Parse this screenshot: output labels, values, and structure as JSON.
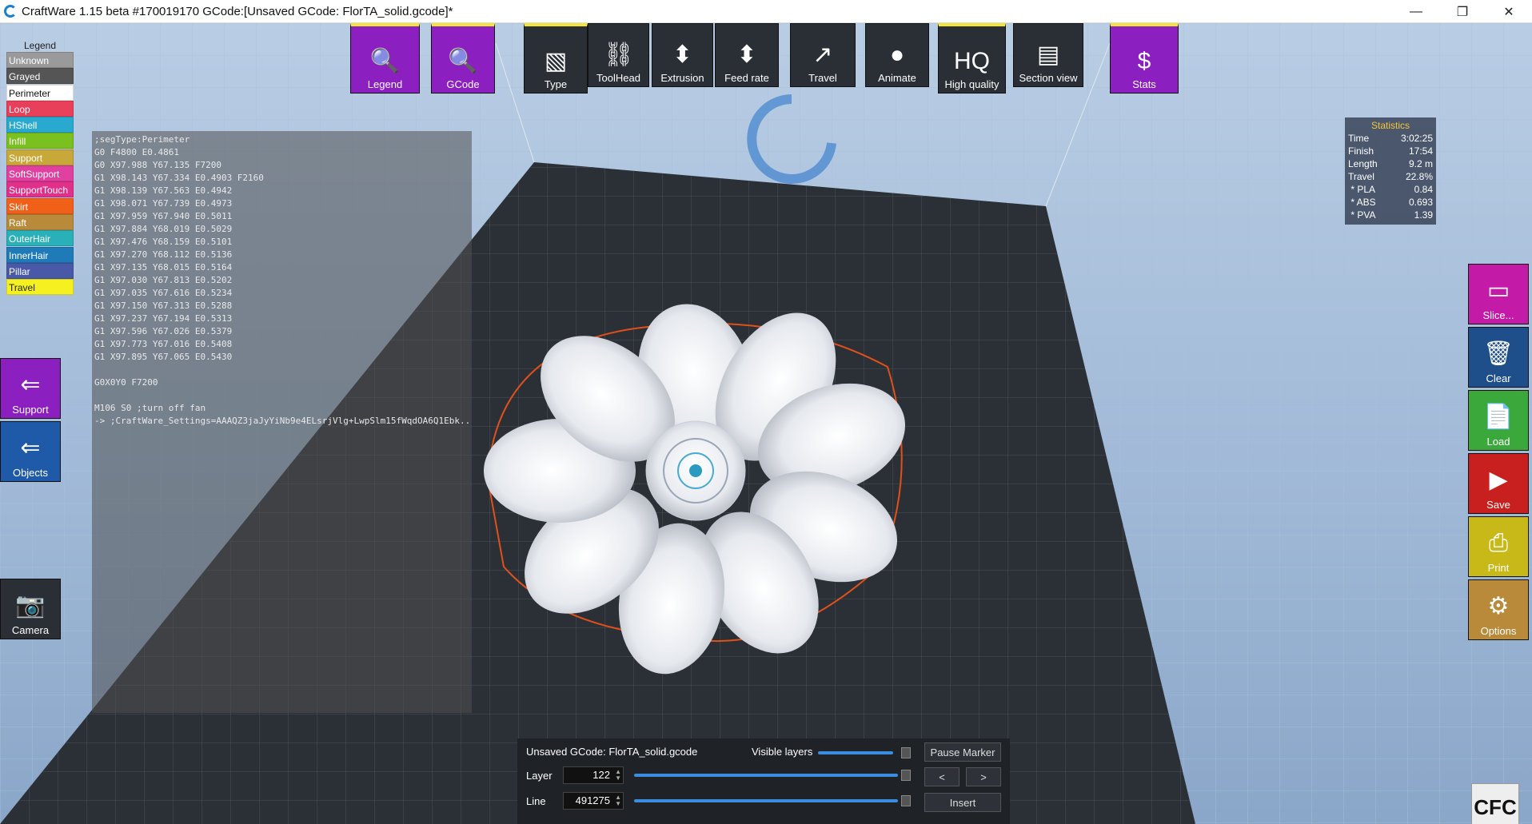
{
  "window": {
    "title": "CraftWare 1.15 beta #170019170   GCode:[Unsaved GCode: FlorTA_solid.gcode]*",
    "minimize": "—",
    "restore": "❐",
    "close": "✕"
  },
  "legend": {
    "title": "Legend",
    "items": [
      {
        "label": "Unknown",
        "color": "#9a9a9a",
        "text": "#ffffff"
      },
      {
        "label": "Grayed",
        "color": "#555555",
        "text": "#ffffff"
      },
      {
        "label": "Perimeter",
        "color": "#ffffff",
        "text": "#111111"
      },
      {
        "label": "Loop",
        "color": "#e8405a",
        "text": "#ffffff"
      },
      {
        "label": "HShell",
        "color": "#2aa9d0",
        "text": "#ffffff"
      },
      {
        "label": "Infill",
        "color": "#7ac01e",
        "text": "#ffffff"
      },
      {
        "label": "Support",
        "color": "#c8a838",
        "text": "#ffffff"
      },
      {
        "label": "SoftSupport",
        "color": "#e040a0",
        "text": "#ffffff"
      },
      {
        "label": "SupportTouch",
        "color": "#e0308a",
        "text": "#ffffff"
      },
      {
        "label": "Skirt",
        "color": "#f06018",
        "text": "#ffffff"
      },
      {
        "label": "Raft",
        "color": "#b88a3a",
        "text": "#ffffff"
      },
      {
        "label": "OuterHair",
        "color": "#2ab0b8",
        "text": "#ffffff"
      },
      {
        "label": "InnerHair",
        "color": "#1f7ab8",
        "text": "#ffffff"
      },
      {
        "label": "Pillar",
        "color": "#4a58a8",
        "text": "#ffffff"
      },
      {
        "label": "Travel",
        "color": "#f5f020",
        "text": "#222222"
      }
    ]
  },
  "gcode_lines": [
    ";segType:Perimeter",
    "G0 F4800 E0.4861",
    "G0 X97.988 Y67.135 F7200",
    "G1 X98.143 Y67.334 E0.4903 F2160",
    "G1 X98.139 Y67.563 E0.4942",
    "G1 X98.071 Y67.739 E0.4973",
    "G1 X97.959 Y67.940 E0.5011",
    "G1 X97.884 Y68.019 E0.5029",
    "G1 X97.476 Y68.159 E0.5101",
    "G1 X97.270 Y68.112 E0.5136",
    "G1 X97.135 Y68.015 E0.5164",
    "G1 X97.030 Y67.813 E0.5202",
    "G1 X97.035 Y67.616 E0.5234",
    "G1 X97.150 Y67.313 E0.5288",
    "G1 X97.237 Y67.194 E0.5313",
    "G1 X97.596 Y67.026 E0.5379",
    "G1 X97.773 Y67.016 E0.5408",
    "G1 X97.895 Y67.065 E0.5430",
    "",
    "G0X0Y0 F7200",
    "",
    "M106 S0 ;turn off fan",
    "-> ;CraftWare_Settings=AAAQZ3jaJyYiNb9e4ELsrjVlg+LwpSlm15fWqdOA6Q1Ebk..."
  ],
  "toolbar": [
    {
      "label": "Legend",
      "icon": "legend-icon",
      "glyph": "🔍"
    },
    {
      "label": "GCode",
      "icon": "gcode-icon",
      "glyph": "🔍"
    },
    {
      "label": "Type",
      "icon": "type-icon",
      "glyph": "▧"
    },
    {
      "label": "ToolHead",
      "icon": "toolhead-icon",
      "glyph": "⛓"
    },
    {
      "label": "Extrusion",
      "icon": "extrusion-icon",
      "glyph": "⬍"
    },
    {
      "label": "Feed rate",
      "icon": "feedrate-icon",
      "glyph": "⬍"
    },
    {
      "label": "Travel",
      "icon": "travel-icon",
      "glyph": "↗"
    },
    {
      "label": "Animate",
      "icon": "animate-icon",
      "glyph": "●"
    },
    {
      "label": "High quality",
      "icon": "hq-icon",
      "glyph": "HQ"
    },
    {
      "label": "Section view",
      "icon": "section-view-icon",
      "glyph": "▤"
    },
    {
      "label": "Stats",
      "icon": "stats-icon",
      "glyph": "$"
    }
  ],
  "left_buttons": [
    {
      "label": "Support",
      "icon": "support-icon",
      "glyph": "⇐"
    },
    {
      "label": "Objects",
      "icon": "objects-icon",
      "glyph": "⇐"
    },
    {
      "label": "Camera",
      "icon": "camera-icon",
      "glyph": "📷"
    }
  ],
  "right_buttons": [
    {
      "label": "Slice...",
      "icon": "slice-icon",
      "glyph": "▭",
      "color": "#c41aa8"
    },
    {
      "label": "Clear",
      "icon": "clear-icon",
      "glyph": "🗑",
      "color": "#1f4f8a"
    },
    {
      "label": "Load",
      "icon": "load-icon",
      "glyph": "📄",
      "color": "#3aa83a"
    },
    {
      "label": "Save",
      "icon": "save-icon",
      "glyph": "▶",
      "color": "#c8201e"
    },
    {
      "label": "Print",
      "icon": "print-icon",
      "glyph": "⎙",
      "color": "#c8b818"
    },
    {
      "label": "Options",
      "icon": "options-icon",
      "glyph": "⚙",
      "color": "#b88a3a"
    }
  ],
  "statistics": {
    "title": "Statistics",
    "rows": [
      {
        "k": "Time",
        "v": "3:02:25"
      },
      {
        "k": "Finish",
        "v": "17:54"
      },
      {
        "k": "Length",
        "v": "9.2 m"
      },
      {
        "k": "Travel",
        "v": "22.8%"
      },
      {
        "k": " * PLA",
        "v": "0.84"
      },
      {
        "k": " * ABS",
        "v": "0.693"
      },
      {
        "k": " * PVA",
        "v": "1.39"
      }
    ]
  },
  "bottom": {
    "filename": "Unsaved GCode: FlorTA_solid.gcode",
    "visible_layers_label": "Visible layers",
    "pause_marker": "Pause Marker",
    "layer_label": "Layer",
    "layer_value": "122",
    "line_label": "Line",
    "line_value": "491275",
    "prev": "<",
    "next": ">",
    "insert": "Insert"
  },
  "logo_text": "CFC"
}
